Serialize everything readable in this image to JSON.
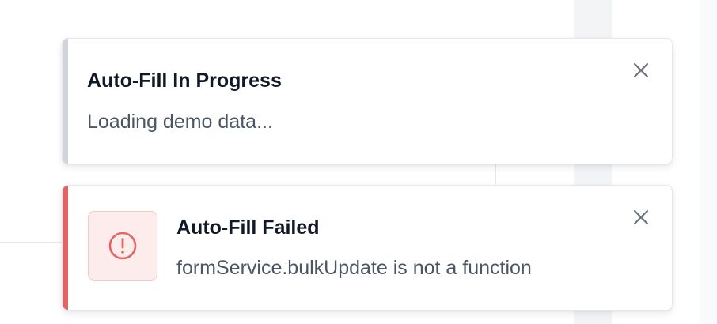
{
  "toasts": {
    "progress": {
      "title": "Auto-Fill In Progress",
      "message": "Loading demo data...",
      "accent_color": "#d1d5db",
      "close_icon": "close-icon"
    },
    "failed": {
      "title": "Auto-Fill Failed",
      "message": "formService.bulkUpdate is not a function",
      "accent_color": "#e06666",
      "status_icon": "alert-circle-icon",
      "close_icon": "close-icon"
    }
  }
}
